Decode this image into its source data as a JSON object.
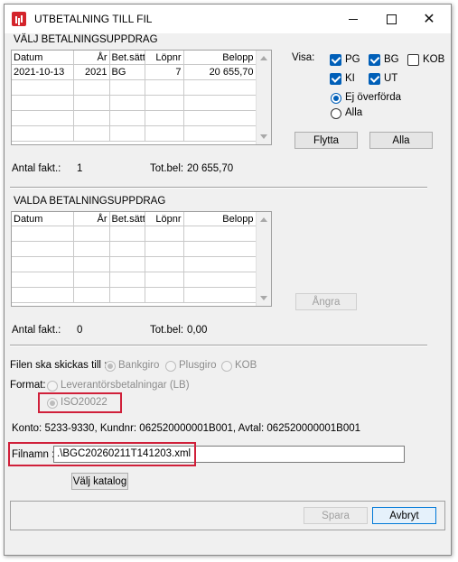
{
  "window": {
    "title": "UTBETALNING TILL FIL"
  },
  "top_section": {
    "title": "VÄLJ BETALNINGSUPPDRAG",
    "columns": [
      "Datum",
      "År",
      "Bet.sätt",
      "Löpnr",
      "Belopp"
    ],
    "rows": [
      {
        "datum": "2021-10-13",
        "ar": "2021",
        "betsatt": "BG",
        "lopnr": "7",
        "belopp": "20 655,70"
      }
    ],
    "antal_label": "Antal fakt.:",
    "antal_value": "1",
    "totbel_label": "Tot.bel:",
    "totbel_value": "20 655,70"
  },
  "visa": {
    "label": "Visa:",
    "checkboxes": [
      {
        "label": "PG",
        "checked": true
      },
      {
        "label": "BG",
        "checked": true
      },
      {
        "label": "KOB",
        "checked": false
      },
      {
        "label": "KI",
        "checked": true
      },
      {
        "label": "UT",
        "checked": true
      }
    ],
    "radios": [
      {
        "label": "Ej överförda",
        "selected": true
      },
      {
        "label": "Alla",
        "selected": false
      }
    ],
    "flytta_label": "Flytta",
    "alla_label": "Alla"
  },
  "bottom_section": {
    "title": "VALDA BETALNINGSUPPDRAG",
    "columns": [
      "Datum",
      "År",
      "Bet.sätt",
      "Löpnr",
      "Belopp"
    ],
    "angra_label": "Ångra",
    "antal_label": "Antal fakt.:",
    "antal_value": "0",
    "totbel_label": "Tot.bel:",
    "totbel_value": "0,00"
  },
  "destination": {
    "label": "Filen ska skickas till :",
    "options": [
      "Bankgiro",
      "Plusgiro",
      "KOB"
    ]
  },
  "format": {
    "label": "Format:",
    "options": [
      "Leverantörsbetalningar (LB)",
      "ISO20022"
    ]
  },
  "konto_text": "Konto: 5233-9330, Kundnr: 062520000001B001, Avtal: 062520000001B001",
  "filnamn": {
    "label": "Filnamn :",
    "value": ".\\BGC20260211T141203.xml"
  },
  "valj_katalog_label": "Välj katalog",
  "spara_label": "Spara",
  "avbryt_label": "Avbryt",
  "colors": {
    "highlight_border": "#d0203a",
    "accent": "#005fb8"
  }
}
